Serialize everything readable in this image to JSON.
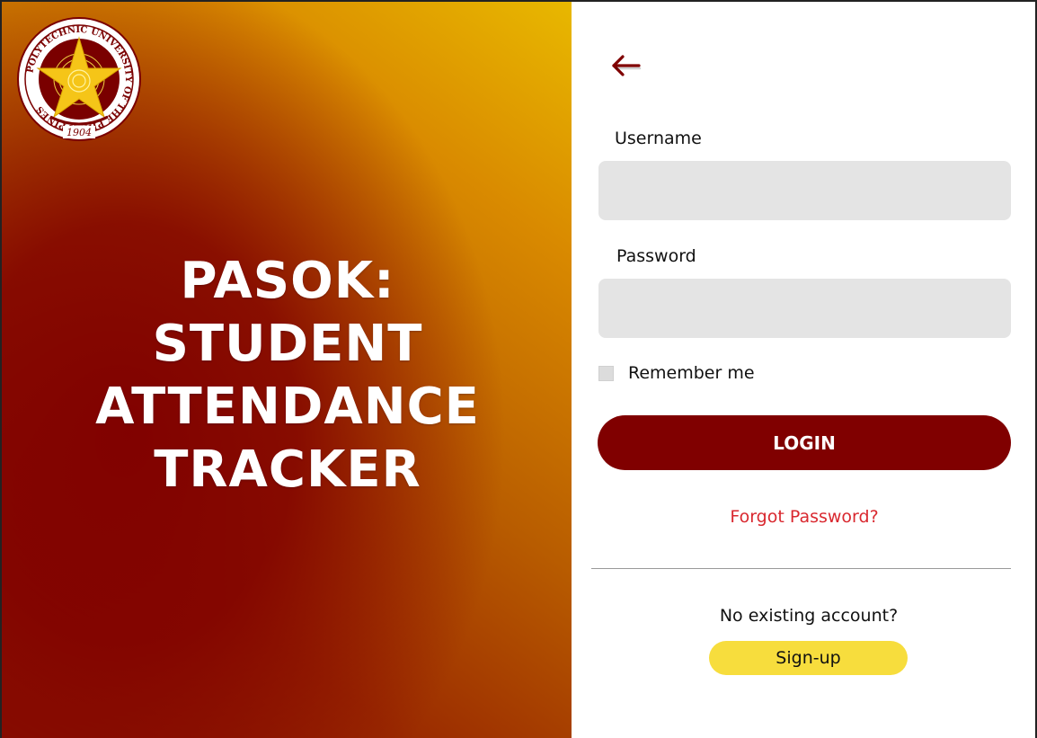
{
  "branding": {
    "logo_icon": "pup-seal-icon",
    "logo_text_ring": "POLYTECHNIC UNIVERSITY OF THE PHILIPPINES",
    "logo_year": "1904",
    "app_title_lines": [
      "PASOK:",
      "STUDENT",
      "ATTENDANCE",
      "TRACKER"
    ]
  },
  "login_form": {
    "back_icon": "arrow-left-icon",
    "username": {
      "label": "Username",
      "value": ""
    },
    "password": {
      "label": "Password",
      "value": ""
    },
    "remember_me": {
      "label": "Remember me",
      "checked": false
    },
    "login_label": "LOGIN",
    "forgot_password": "Forgot Password?",
    "no_account_text": "No existing account?",
    "signup_label": "Sign-up"
  },
  "colors": {
    "primary_maroon": "#800000",
    "accent_gold": "#e8b800",
    "signup_yellow": "#f7dd3d",
    "link_red": "#d9282f",
    "input_bg": "#e4e4e4"
  }
}
